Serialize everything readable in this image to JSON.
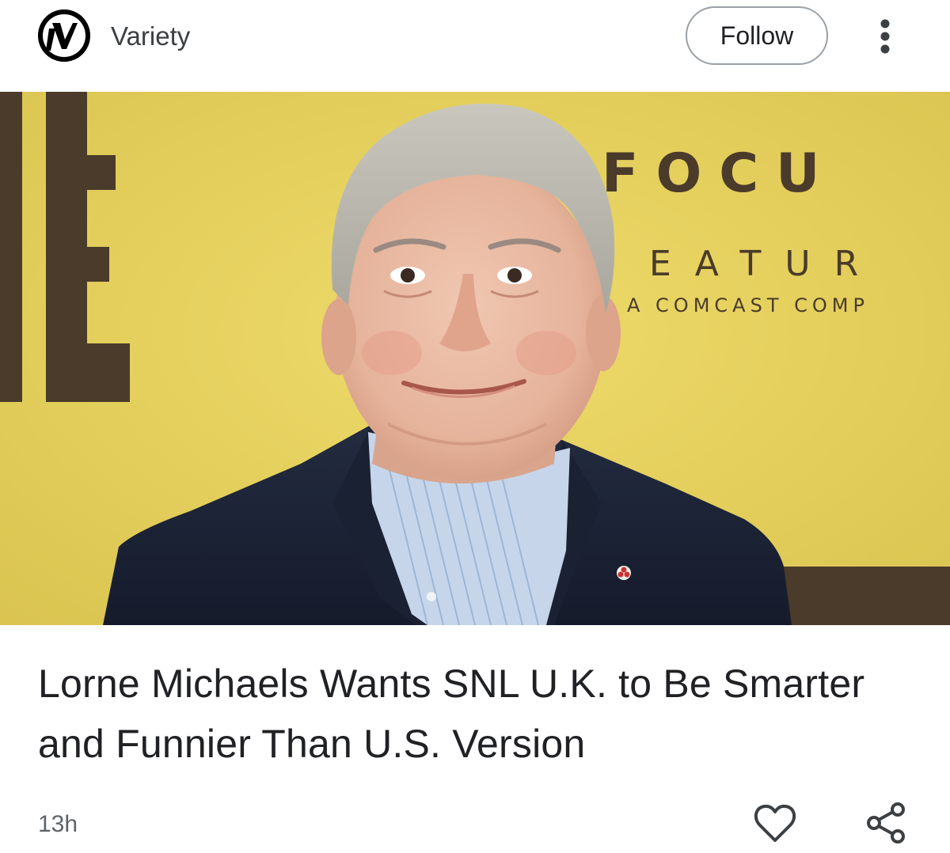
{
  "header": {
    "source_logo_icon": "variety-v-logo",
    "source_name": "Variety",
    "follow_label": "Follow",
    "more_icon": "more-vert-icon"
  },
  "hero_image": {
    "backdrop_logo_word": "FOCU",
    "backdrop_logo_sub": "EATUR",
    "backdrop_logo_tag": "A COMCAST COMP"
  },
  "article": {
    "headline": "Lorne Michaels Wants SNL U.K. to Be Smarter and Funnier Than U.S. Version",
    "age": "13h"
  },
  "actions": {
    "like_icon": "heart-outline-icon",
    "share_icon": "share-icon"
  },
  "colors": {
    "backdrop_yellow": "#e8d35c",
    "jacket_navy": "#1c2438",
    "text_primary": "#202124",
    "text_secondary": "#5f6368"
  }
}
